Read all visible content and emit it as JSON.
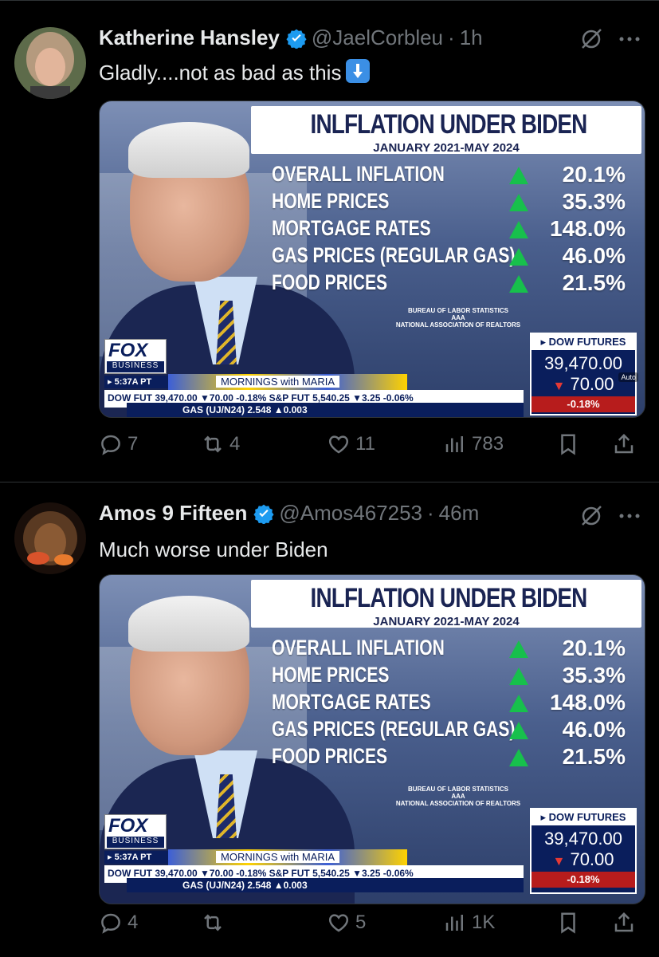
{
  "tweets": [
    {
      "display_name": "Katherine Hansley",
      "handle": "@JaelCorbleu",
      "separator": "·",
      "time": "1h",
      "text": "Gladly....not as bad as this",
      "emoji": "down-arrow-emoji",
      "media": {
        "headline": "INLFLATION UNDER BIDEN",
        "subhead": "JANUARY 2021-MAY 2024",
        "rows": [
          {
            "label": "OVERALL INFLATION",
            "value": "20.1%"
          },
          {
            "label": "HOME PRICES",
            "value": "35.3%"
          },
          {
            "label": "MORTGAGE RATES",
            "value": "148.0%"
          },
          {
            "label": "GAS PRICES (REGULAR GAS)",
            "value": "46.0%"
          },
          {
            "label": "FOOD PRICES",
            "value": "21.5%"
          }
        ],
        "sources": [
          "BUREAU OF LABOR STATISTICS",
          "AAA",
          "NATIONAL ASSOCIATION OF REALTORS"
        ],
        "network": "FOX",
        "network_sub": "BUSINESS",
        "clock": "▸ 5:37A PT",
        "show": "MORNINGS with MARIA",
        "ticker1": "DOW FUT 39,470.00 ▼70.00 -0.18% S&P FUT 5,540.25 ▼3.25 -0.06%",
        "ticker2": "GAS (UJ/N24) 2.548 ▲0.003",
        "dow_title": "▸ DOW FUTURES",
        "dow_value": "39,470.00",
        "dow_change": "70.00",
        "dow_pct": "-0.18%",
        "auto_badge": "Auto"
      },
      "stats": {
        "replies": "7",
        "retweets": "4",
        "likes": "11",
        "views": "783"
      }
    },
    {
      "display_name": "Amos 9 Fifteen",
      "handle": "@Amos467253",
      "separator": "·",
      "time": "46m",
      "text": "Much worse under Biden",
      "media": {
        "headline": "INLFLATION UNDER BIDEN",
        "subhead": "JANUARY 2021-MAY 2024",
        "rows": [
          {
            "label": "OVERALL INFLATION",
            "value": "20.1%"
          },
          {
            "label": "HOME PRICES",
            "value": "35.3%"
          },
          {
            "label": "MORTGAGE RATES",
            "value": "148.0%"
          },
          {
            "label": "GAS PRICES (REGULAR GAS)",
            "value": "46.0%"
          },
          {
            "label": "FOOD PRICES",
            "value": "21.5%"
          }
        ],
        "sources": [
          "BUREAU OF LABOR STATISTICS",
          "AAA",
          "NATIONAL ASSOCIATION OF REALTORS"
        ],
        "network": "FOX",
        "network_sub": "BUSINESS",
        "clock": "▸ 5:37A PT",
        "show": "MORNINGS with MARIA",
        "ticker1": "DOW FUT 39,470.00 ▼70.00 -0.18% S&P FUT 5,540.25 ▼3.25 -0.06%",
        "ticker2": "GAS (UJ/N24) 2.548 ▲0.003",
        "dow_title": "▸ DOW FUTURES",
        "dow_value": "39,470.00",
        "dow_change": "70.00",
        "dow_pct": "-0.18%"
      },
      "stats": {
        "replies": "4",
        "retweets": "",
        "likes": "5",
        "views": "1K"
      }
    }
  ],
  "colors": {
    "background": "#000000",
    "verified": "#1d9bf0",
    "muted": "#71767b",
    "text": "#e7e9ea",
    "up": "#17c04c"
  }
}
